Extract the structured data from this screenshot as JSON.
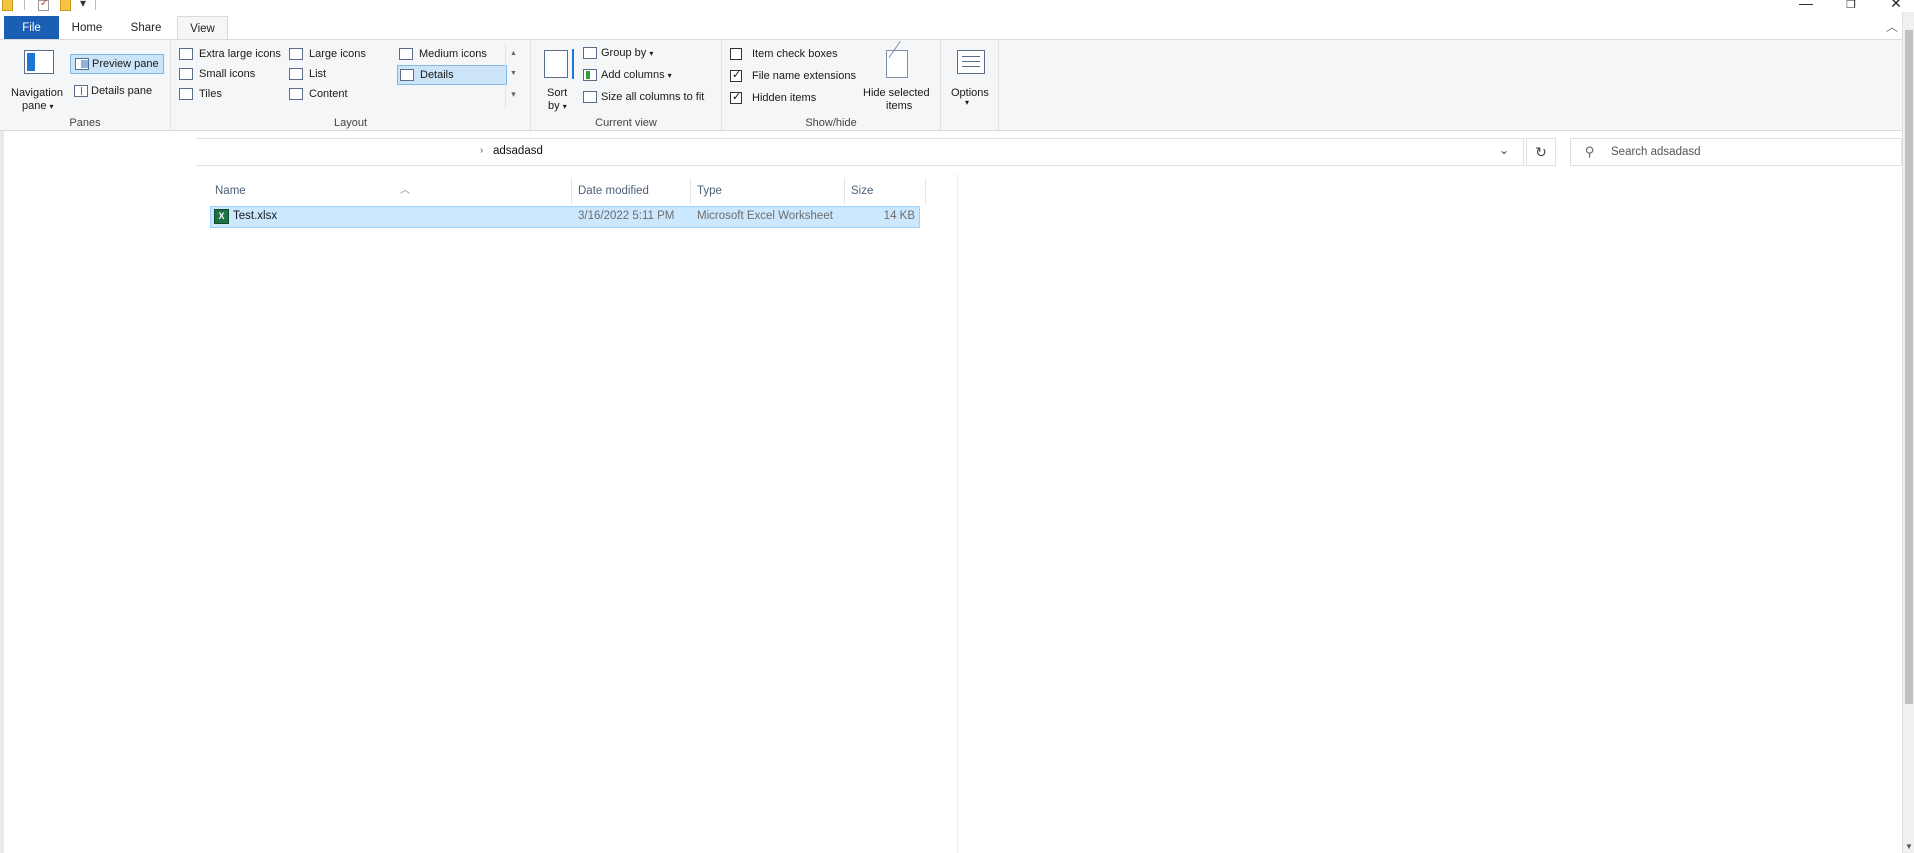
{
  "ribbon_tabs": {
    "file": "File",
    "home": "Home",
    "share": "Share",
    "view": "View"
  },
  "panes": {
    "label": "Panes",
    "navigation_pane_line1": "Navigation",
    "navigation_pane_line2": "pane",
    "preview_pane": "Preview pane",
    "details_pane": "Details pane"
  },
  "layout": {
    "label": "Layout",
    "extra_large_icons": "Extra large icons",
    "large_icons": "Large icons",
    "medium_icons": "Medium icons",
    "small_icons": "Small icons",
    "list": "List",
    "details": "Details",
    "tiles": "Tiles",
    "content": "Content",
    "selected": "Details"
  },
  "current_view": {
    "label": "Current view",
    "sort_by_line1": "Sort",
    "sort_by_line2": "by",
    "group_by": "Group by",
    "add_columns": "Add columns",
    "size_all_columns": "Size all columns to fit"
  },
  "show_hide": {
    "label": "Show/hide",
    "item_check_boxes": "Item check boxes",
    "item_check_boxes_checked": false,
    "file_name_extensions": "File name extensions",
    "file_name_extensions_checked": true,
    "hidden_items": "Hidden items",
    "hidden_items_checked": true,
    "hide_selected_line1": "Hide selected",
    "hide_selected_line2": "items"
  },
  "options": {
    "label": "Options"
  },
  "address": {
    "current_folder": "adsadasd"
  },
  "search": {
    "placeholder": "Search adsadasd"
  },
  "columns": {
    "name": "Name",
    "date_modified": "Date modified",
    "type": "Type",
    "size": "Size"
  },
  "files": [
    {
      "name": "Test.xlsx",
      "date_modified": "3/16/2022 5:11 PM",
      "type": "Microsoft Excel Worksheet",
      "size": "14 KB"
    }
  ],
  "colors": {
    "file_tab": "#1a5fb4",
    "selection": "#cce8ff",
    "ribbon_bg": "#f5f6f7"
  }
}
